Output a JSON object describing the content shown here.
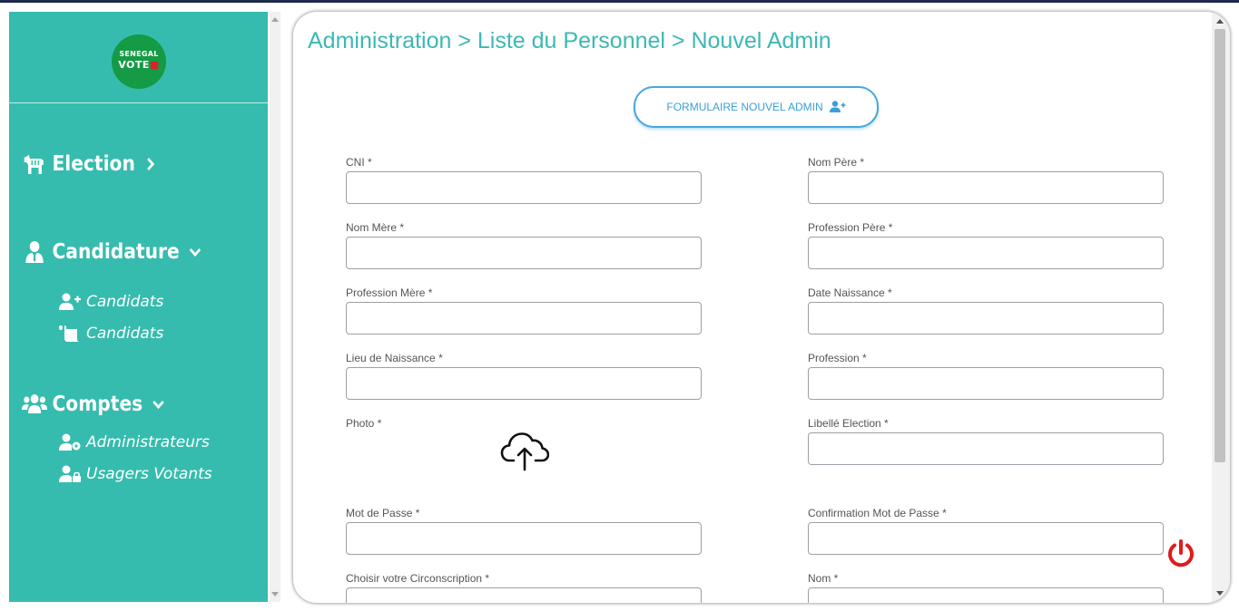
{
  "colors": {
    "sidebar_bg": "#36bcae",
    "breadcrumb": "#3cb8b4",
    "button_accent": "#48a7dc",
    "logout": "#e01b1b",
    "logo_bg": "#159a45"
  },
  "logo": {
    "line1": "SENEGAL",
    "line2": "VOTE"
  },
  "sidebar": {
    "sections": [
      {
        "label": "Election",
        "icon": "donkey-icon",
        "chevron": "chevron-right-icon"
      },
      {
        "label": "Candidature",
        "icon": "user-tie-icon",
        "chevron": "chevron-down-icon",
        "items": [
          {
            "label": "Candidats",
            "icon": "user-plus-icon"
          },
          {
            "label": "Candidats",
            "icon": "scroll-icon"
          }
        ]
      },
      {
        "label": "Comptes",
        "icon": "users-icon",
        "chevron": "chevron-down-icon",
        "items": [
          {
            "label": "Administrateurs",
            "icon": "user-cog-icon"
          },
          {
            "label": "Usagers Votants",
            "icon": "user-lock-icon"
          }
        ]
      }
    ]
  },
  "main": {
    "breadcrumb": "Administration > Liste du Personnel > Nouvel Admin",
    "form_button": {
      "label": "FORMULAIRE NOUVEL ADMIN",
      "icon": "user-plus-icon"
    },
    "fields": {
      "cni": "CNI *",
      "nom_pere": "Nom Père *",
      "nom_mere": "Nom Mère *",
      "profession_pere": "Profession Père *",
      "profession_mere": "Profession Mère *",
      "date_naissance": "Date Naissance *",
      "lieu_naissance": "Lieu de Naissance *",
      "profession": "Profession *",
      "photo": "Photo *",
      "libelle_election": "Libellé Election *",
      "mot_de_passe": "Mot de Passe *",
      "confirmation_mdp": "Confirmation Mot de Passe *",
      "circonscription": "Choisir votre Circonscription *",
      "nom": "Nom *"
    }
  }
}
